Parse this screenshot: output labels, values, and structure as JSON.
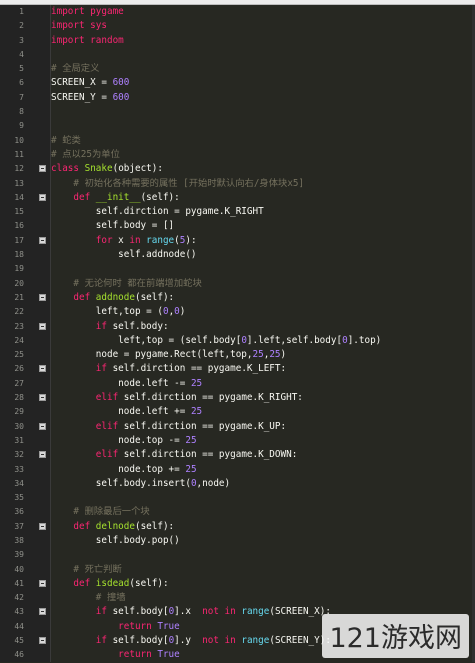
{
  "editor": {
    "lines": [
      {
        "n": "1",
        "fold": false,
        "segs": [
          {
            "t": "import pygame",
            "c": "kw"
          }
        ]
      },
      {
        "n": "2",
        "fold": false,
        "segs": [
          {
            "t": "import sys",
            "c": "kw"
          }
        ]
      },
      {
        "n": "3",
        "fold": false,
        "segs": [
          {
            "t": "import random",
            "c": "kw"
          }
        ]
      },
      {
        "n": "4",
        "fold": false,
        "segs": []
      },
      {
        "n": "5",
        "fold": false,
        "segs": [
          {
            "t": "# 全局定义",
            "c": "cm"
          }
        ]
      },
      {
        "n": "6",
        "fold": false,
        "segs": [
          {
            "t": "SCREEN_X = ",
            "c": "nm"
          },
          {
            "t": "600",
            "c": "num"
          }
        ]
      },
      {
        "n": "7",
        "fold": false,
        "segs": [
          {
            "t": "SCREEN_Y = ",
            "c": "nm"
          },
          {
            "t": "600",
            "c": "num"
          }
        ]
      },
      {
        "n": "8",
        "fold": false,
        "segs": []
      },
      {
        "n": "9",
        "fold": false,
        "segs": []
      },
      {
        "n": "10",
        "fold": false,
        "segs": [
          {
            "t": "# 蛇类",
            "c": "cm"
          }
        ]
      },
      {
        "n": "11",
        "fold": false,
        "segs": [
          {
            "t": "# 点以25为单位",
            "c": "cm"
          }
        ]
      },
      {
        "n": "12",
        "fold": true,
        "segs": [
          {
            "t": "class ",
            "c": "kw"
          },
          {
            "t": "Snake",
            "c": "fn"
          },
          {
            "t": "(object):",
            "c": "nm"
          }
        ]
      },
      {
        "n": "13",
        "fold": false,
        "segs": [
          {
            "t": "    # 初始化各种需要的属性 [开始时默认向右/身体块x5]",
            "c": "cm"
          }
        ]
      },
      {
        "n": "14",
        "fold": true,
        "segs": [
          {
            "t": "    ",
            "c": "nm"
          },
          {
            "t": "def ",
            "c": "kw"
          },
          {
            "t": "__init__",
            "c": "fn"
          },
          {
            "t": "(self):",
            "c": "nm"
          }
        ]
      },
      {
        "n": "15",
        "fold": false,
        "segs": [
          {
            "t": "        self.dirction = pygame.K_RIGHT",
            "c": "nm"
          }
        ]
      },
      {
        "n": "16",
        "fold": false,
        "segs": [
          {
            "t": "        self.body = []",
            "c": "nm"
          }
        ]
      },
      {
        "n": "17",
        "fold": true,
        "segs": [
          {
            "t": "        ",
            "c": "nm"
          },
          {
            "t": "for ",
            "c": "kw"
          },
          {
            "t": "x ",
            "c": "nm"
          },
          {
            "t": "in ",
            "c": "kw"
          },
          {
            "t": "range",
            "c": "bi"
          },
          {
            "t": "(",
            "c": "nm"
          },
          {
            "t": "5",
            "c": "num"
          },
          {
            "t": "):",
            "c": "nm"
          }
        ]
      },
      {
        "n": "18",
        "fold": false,
        "segs": [
          {
            "t": "            self.addnode()",
            "c": "nm"
          }
        ]
      },
      {
        "n": "19",
        "fold": false,
        "segs": []
      },
      {
        "n": "20",
        "fold": false,
        "segs": [
          {
            "t": "    # 无论何时 都在前端增加蛇块",
            "c": "cm"
          }
        ]
      },
      {
        "n": "21",
        "fold": true,
        "segs": [
          {
            "t": "    ",
            "c": "nm"
          },
          {
            "t": "def ",
            "c": "kw"
          },
          {
            "t": "addnode",
            "c": "fn"
          },
          {
            "t": "(self):",
            "c": "nm"
          }
        ]
      },
      {
        "n": "22",
        "fold": false,
        "segs": [
          {
            "t": "        left,top = (",
            "c": "nm"
          },
          {
            "t": "0",
            "c": "num"
          },
          {
            "t": ",",
            "c": "nm"
          },
          {
            "t": "0",
            "c": "num"
          },
          {
            "t": ")",
            "c": "nm"
          }
        ]
      },
      {
        "n": "23",
        "fold": true,
        "segs": [
          {
            "t": "        ",
            "c": "nm"
          },
          {
            "t": "if ",
            "c": "kw"
          },
          {
            "t": "self.body:",
            "c": "nm"
          }
        ]
      },
      {
        "n": "24",
        "fold": false,
        "segs": [
          {
            "t": "            left,top = (self.body[",
            "c": "nm"
          },
          {
            "t": "0",
            "c": "num"
          },
          {
            "t": "].left,self.body[",
            "c": "nm"
          },
          {
            "t": "0",
            "c": "num"
          },
          {
            "t": "].top)",
            "c": "nm"
          }
        ]
      },
      {
        "n": "25",
        "fold": false,
        "segs": [
          {
            "t": "        node = pygame.Rect(left,top,",
            "c": "nm"
          },
          {
            "t": "25",
            "c": "num"
          },
          {
            "t": ",",
            "c": "nm"
          },
          {
            "t": "25",
            "c": "num"
          },
          {
            "t": ")",
            "c": "nm"
          }
        ]
      },
      {
        "n": "26",
        "fold": true,
        "segs": [
          {
            "t": "        ",
            "c": "nm"
          },
          {
            "t": "if ",
            "c": "kw"
          },
          {
            "t": "self.dirction == pygame.K_LEFT:",
            "c": "nm"
          }
        ]
      },
      {
        "n": "27",
        "fold": false,
        "segs": [
          {
            "t": "            node.left -= ",
            "c": "nm"
          },
          {
            "t": "25",
            "c": "num"
          }
        ]
      },
      {
        "n": "28",
        "fold": true,
        "segs": [
          {
            "t": "        ",
            "c": "nm"
          },
          {
            "t": "elif ",
            "c": "kw"
          },
          {
            "t": "self.dirction == pygame.K_RIGHT:",
            "c": "nm"
          }
        ]
      },
      {
        "n": "29",
        "fold": false,
        "segs": [
          {
            "t": "            node.left += ",
            "c": "nm"
          },
          {
            "t": "25",
            "c": "num"
          }
        ]
      },
      {
        "n": "30",
        "fold": true,
        "segs": [
          {
            "t": "        ",
            "c": "nm"
          },
          {
            "t": "elif ",
            "c": "kw"
          },
          {
            "t": "self.dirction == pygame.K_UP:",
            "c": "nm"
          }
        ]
      },
      {
        "n": "31",
        "fold": false,
        "segs": [
          {
            "t": "            node.top -= ",
            "c": "nm"
          },
          {
            "t": "25",
            "c": "num"
          }
        ]
      },
      {
        "n": "32",
        "fold": true,
        "segs": [
          {
            "t": "        ",
            "c": "nm"
          },
          {
            "t": "elif ",
            "c": "kw"
          },
          {
            "t": "self.dirction == pygame.K_DOWN:",
            "c": "nm"
          }
        ]
      },
      {
        "n": "33",
        "fold": false,
        "segs": [
          {
            "t": "            node.top += ",
            "c": "nm"
          },
          {
            "t": "25",
            "c": "num"
          }
        ]
      },
      {
        "n": "34",
        "fold": false,
        "segs": [
          {
            "t": "        self.body.insert(",
            "c": "nm"
          },
          {
            "t": "0",
            "c": "num"
          },
          {
            "t": ",node)",
            "c": "nm"
          }
        ]
      },
      {
        "n": "35",
        "fold": false,
        "segs": []
      },
      {
        "n": "36",
        "fold": false,
        "segs": [
          {
            "t": "    # 删除最后一个块",
            "c": "cm"
          }
        ]
      },
      {
        "n": "37",
        "fold": true,
        "segs": [
          {
            "t": "    ",
            "c": "nm"
          },
          {
            "t": "def ",
            "c": "kw"
          },
          {
            "t": "delnode",
            "c": "fn"
          },
          {
            "t": "(self):",
            "c": "nm"
          }
        ]
      },
      {
        "n": "38",
        "fold": false,
        "segs": [
          {
            "t": "        self.body.pop()",
            "c": "nm"
          }
        ]
      },
      {
        "n": "39",
        "fold": false,
        "segs": []
      },
      {
        "n": "40",
        "fold": false,
        "segs": [
          {
            "t": "    # 死亡判断",
            "c": "cm"
          }
        ]
      },
      {
        "n": "41",
        "fold": true,
        "segs": [
          {
            "t": "    ",
            "c": "nm"
          },
          {
            "t": "def ",
            "c": "kw"
          },
          {
            "t": "isdead",
            "c": "fn"
          },
          {
            "t": "(self):",
            "c": "nm"
          }
        ]
      },
      {
        "n": "42",
        "fold": false,
        "segs": [
          {
            "t": "        # 撞墙",
            "c": "cm"
          }
        ]
      },
      {
        "n": "43",
        "fold": true,
        "segs": [
          {
            "t": "        ",
            "c": "nm"
          },
          {
            "t": "if ",
            "c": "kw"
          },
          {
            "t": "self.body[",
            "c": "nm"
          },
          {
            "t": "0",
            "c": "num"
          },
          {
            "t": "].x  ",
            "c": "nm"
          },
          {
            "t": "not in ",
            "c": "kw"
          },
          {
            "t": "range",
            "c": "bi"
          },
          {
            "t": "(SCREEN_X):",
            "c": "nm"
          }
        ]
      },
      {
        "n": "44",
        "fold": false,
        "segs": [
          {
            "t": "            ",
            "c": "nm"
          },
          {
            "t": "return ",
            "c": "kw"
          },
          {
            "t": "True",
            "c": "num"
          }
        ]
      },
      {
        "n": "45",
        "fold": true,
        "segs": [
          {
            "t": "        ",
            "c": "nm"
          },
          {
            "t": "if ",
            "c": "kw"
          },
          {
            "t": "self.body[",
            "c": "nm"
          },
          {
            "t": "0",
            "c": "num"
          },
          {
            "t": "].y  ",
            "c": "nm"
          },
          {
            "t": "not in ",
            "c": "kw"
          },
          {
            "t": "range",
            "c": "bi"
          },
          {
            "t": "(SCREEN_Y):",
            "c": "nm"
          }
        ]
      },
      {
        "n": "46",
        "fold": false,
        "segs": [
          {
            "t": "            ",
            "c": "nm"
          },
          {
            "t": "return ",
            "c": "kw"
          },
          {
            "t": "True",
            "c": "num"
          }
        ]
      }
    ]
  },
  "watermark": {
    "text": "121游戏网"
  },
  "colors": {
    "background": "#272822",
    "gutter": "#232323",
    "keyword": "#f92672",
    "comment": "#75715e",
    "function": "#a6e22e",
    "number": "#ae81ff"
  }
}
